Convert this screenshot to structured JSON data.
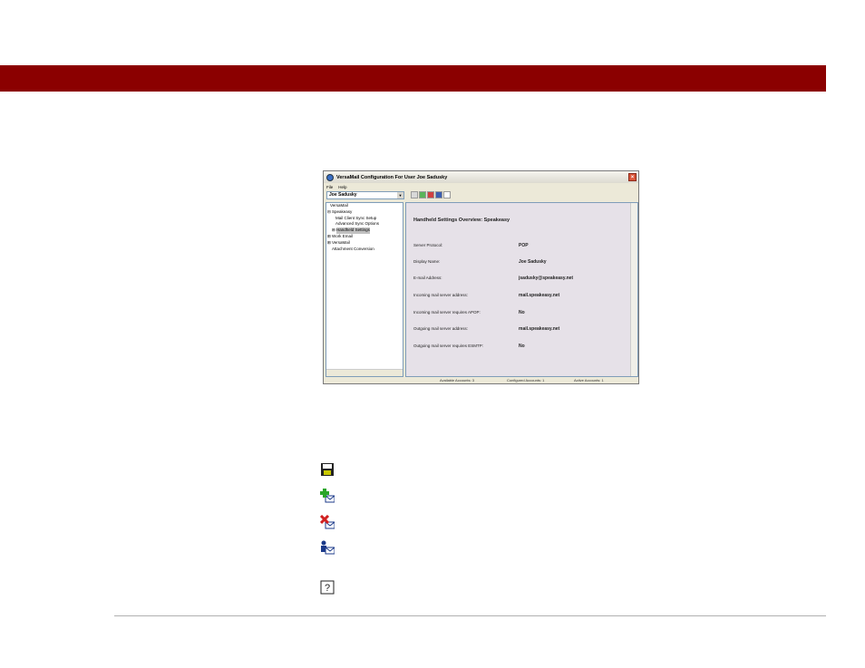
{
  "colors": {
    "header_bar": "#8b0000",
    "content_bg": "#e6e1e8"
  },
  "window": {
    "title": "VersaMail Configuration For User Joe Sadusky",
    "menu": [
      "File",
      "Help"
    ],
    "account_select": "Joe Sadusky",
    "toolbar_icons": [
      "save-icon",
      "add-account-icon",
      "delete-account-icon",
      "user-settings-icon",
      "help-icon"
    ]
  },
  "tree": {
    "items": [
      {
        "label": "VersaMail"
      },
      {
        "label": "Speakeasy",
        "toggle": "⊟"
      },
      {
        "label": "Mail Client Sync Setup"
      },
      {
        "label": "Advanced Sync Options"
      },
      {
        "label": "Handheld Settings",
        "toggle": "⊞"
      },
      {
        "label": "Work Email",
        "toggle": "⊞"
      },
      {
        "label": "VersaMail",
        "toggle": "⊞"
      },
      {
        "label": "Attachment Conversion"
      }
    ]
  },
  "content": {
    "title": "Handheld Settings Overview: Speakeasy",
    "rows": [
      {
        "label": "Server Protocol:",
        "value": "POP"
      },
      {
        "label": "Display Name:",
        "value": "Joe Sadusky"
      },
      {
        "label": "E-mail Address:",
        "value": "jsadusky@speakeasy.net"
      },
      {
        "label": "Incoming mail server address:",
        "value": "mail.speakeasy.net"
      },
      {
        "label": "Incoming mail server requires APOP:",
        "value": "No"
      },
      {
        "label": "Outgoing mail server address:",
        "value": "mail.speakeasy.net"
      },
      {
        "label": "Outgoing mail server requires ESMTP:",
        "value": "No"
      }
    ]
  },
  "status": {
    "available": "Available Accounts: 3",
    "configured": "Configured Accounts: 1",
    "active": "Active Accounts: 1"
  },
  "legend_icons": [
    "save-icon",
    "add-account-icon",
    "delete-account-icon",
    "user-settings-icon",
    "help-icon"
  ]
}
